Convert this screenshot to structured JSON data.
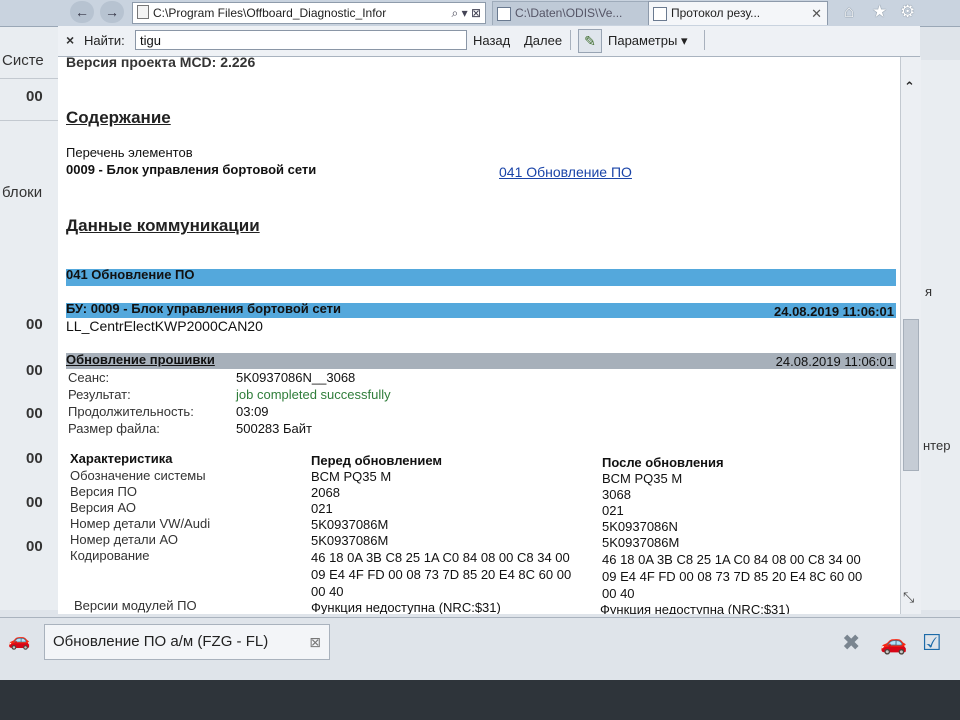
{
  "browser": {
    "address": "C:\\Program Files\\Offboard_Diagnostic_Infor",
    "address_tools": "⌕ ▾ ⊠",
    "tabs": [
      {
        "label": "C:\\Daten\\ODIS\\Ve...",
        "active": false
      },
      {
        "label": "Протокол резу...",
        "active": true
      }
    ],
    "tab_close": "✕"
  },
  "findbar": {
    "close": "×",
    "label": "Найти:",
    "value": "tigu",
    "back": "Назад",
    "next": "Далее",
    "params": "Параметры"
  },
  "background": {
    "left_labels": [
      "Систе",
      "блоки"
    ],
    "left_nums": [
      "00",
      "00",
      "00",
      "00",
      "00",
      "00",
      "00"
    ],
    "right_texts": [
      "я",
      "нтер"
    ]
  },
  "report": {
    "project_version": "Версия проекта MCD: 2.226",
    "contents_heading": "Содержание",
    "elements_list": "Перечень элементов",
    "module_entry": "0009 - Блок управления бортовой сети",
    "module_link": "041 Обновление ПО",
    "comm_heading": "Данные коммуникации",
    "section_band": "041 Обновление ПО",
    "ecu_band": "БУ: 0009 - Блок управления бортовой сети",
    "ecu_datetime": "24.08.2019 11:06:01",
    "ecu_name": "LL_CentrElectKWP2000CAN20",
    "firmware_band": "Обновление прошивки",
    "firmware_datetime": "24.08.2019 11:06:01",
    "session_label": "Сеанс:",
    "session_value": "5K0937086N__3068",
    "result_label": "Результат:",
    "result_value": "job completed successfully",
    "duration_label": "Продолжительность:",
    "duration_value": "03:09",
    "filesize_label": "Размер файла:",
    "filesize_value": "500283 Байт",
    "table": {
      "headers": [
        "Характеристика",
        "Перед обновлением",
        "После обновления"
      ],
      "rows": [
        {
          "name": "Обозначение системы",
          "before": "BCM PQ35 M",
          "after": "BCM PQ35 M"
        },
        {
          "name": "Версия ПО",
          "before": "2068",
          "after": "3068"
        },
        {
          "name": "Версия АО",
          "before": "021",
          "after": "021"
        },
        {
          "name": "Номер детали VW/Audi",
          "before": "5K0937086M",
          "after": "5K0937086N"
        },
        {
          "name": "Номер детали АО",
          "before": "5K0937086M",
          "after": "5K0937086M"
        }
      ],
      "coding_label": "Кодирование",
      "coding_before": [
        "46 18 0A 3B C8 25 1A C0 84 08 00 C8 34 00",
        "09 E4 4F FD 00 08 73 7D 85 20 E4 8C 60 00",
        "00 40"
      ],
      "coding_after": [
        "46 18 0A 3B C8 25 1A C0 84 08 00 C8 34 00",
        "09 E4 4F FD 00 08 73 7D 85 20 E4 8C 60 00",
        "00 40"
      ],
      "modules_label": "Версии модулей ПО",
      "modules_before": "Функция недоступна (NRC:$31)",
      "modules_after": "Функция недоступна (NRC:$31)"
    }
  },
  "taskbar": {
    "task_label": "Обновление ПО а/м (FZG - FL)",
    "task_close": "⊠"
  }
}
